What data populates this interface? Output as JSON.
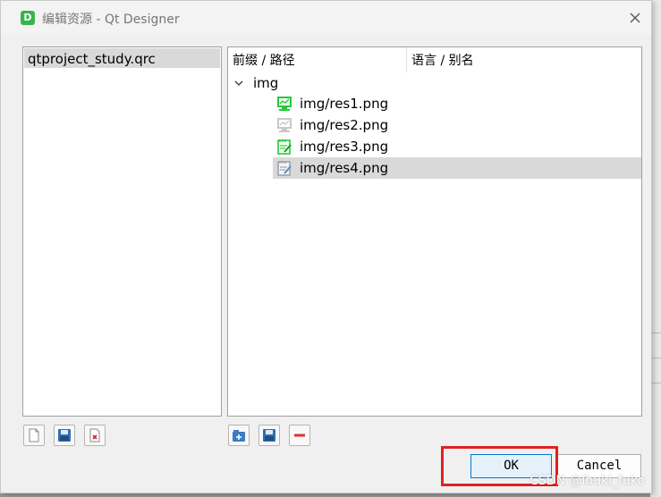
{
  "window": {
    "app_icon_letter": "D",
    "title": "编辑资源 - Qt Designer"
  },
  "left_panel": {
    "items": [
      "qtproject_study.qrc"
    ]
  },
  "right_panel": {
    "columns": [
      "前缀 / 路径",
      "语言 / 别名"
    ],
    "prefix": "img",
    "files": [
      {
        "path": "img/res1.png",
        "icon": "green-monitor-icon"
      },
      {
        "path": "img/res2.png",
        "icon": "grey-monitor-icon"
      },
      {
        "path": "img/res3.png",
        "icon": "green-notepad-icon"
      },
      {
        "path": "img/res4.png",
        "icon": "grey-notepad-icon",
        "selected": true
      }
    ]
  },
  "left_toolbar": [
    "new-file-icon",
    "save-icon",
    "remove-file-icon"
  ],
  "right_toolbar": [
    "add-prefix-icon",
    "add-files-icon",
    "remove-icon"
  ],
  "buttons": {
    "ok": "OK",
    "cancel": "Cancel"
  },
  "watermark": "CSDN @ibuki_fuko",
  "colors": {
    "selection": "#d9d9d9",
    "accent_green": "#38b54a",
    "highlight_red": "#e02020"
  }
}
